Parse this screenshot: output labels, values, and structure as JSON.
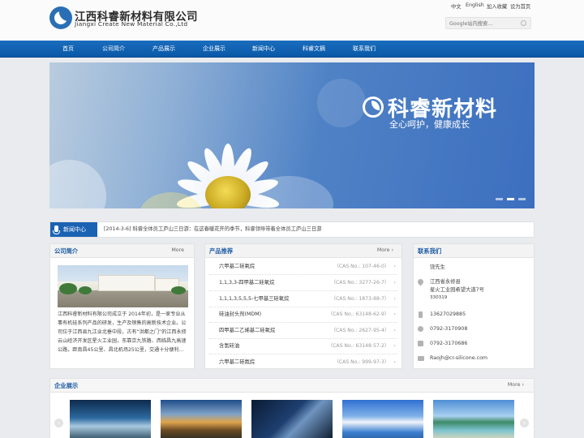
{
  "header": {
    "logo_cn": "江西科睿新材料有限公司",
    "logo_en": "Jiangxi Create New Material Co.,Ltd",
    "top_links": [
      "中文",
      "English",
      "加入收藏",
      "设为首页"
    ],
    "search_placeholder": "Google站内搜索..."
  },
  "nav": [
    "首页",
    "公司简介",
    "产品展示",
    "企业展示",
    "新闻中心",
    "科睿文摘",
    "联系我们"
  ],
  "banner": {
    "brand": "科睿新材料",
    "slogan": "全心呵护，健康成长",
    "slide_count": 3,
    "active_slide": 2
  },
  "ticker": {
    "title": "新闻中心",
    "text": "[2014-3-6]  科睿全体员工庐山三日游：在这春暖花开的季节，科睿领导带着全体员工庐山三日游"
  },
  "about": {
    "title": "公司简介",
    "more": "More",
    "text": "江西科睿新材料有限公司成立于 2014年初，是一家专业从事有机硅系列产品的研发，生产及销售的高新技术企业。公司位于江西县九江业北垂中段，古有“洪都之门”的江西永修云山经济开发区星火工业园，东靠京九铁路、西临昌九高速公路，距南昌45公里、昌北机场25公里，交通十分便利..."
  },
  "products": {
    "title": "产品推荐",
    "more": "More",
    "items": [
      {
        "name": "六甲基二硅氧烷",
        "cas": "（CAS No.: 107-46-0）"
      },
      {
        "name": "1,1,3,3-四甲基二硅氧烷",
        "cas": "（CAS No.: 3277-26-7）"
      },
      {
        "name": "1,1,1,3,5,5,5-七甲基三硅氧烷",
        "cas": "（CAS No.: 1873-88-7）"
      },
      {
        "name": "硅油封头剂(MDM)",
        "cas": "（CAS No.: 63148-62-9）"
      },
      {
        "name": "四甲基二乙烯基二硅氧烷",
        "cas": "（CAS No.: 2627-95-4）"
      },
      {
        "name": "含氢硅油",
        "cas": "（CAS No.: 63148-57-2）"
      },
      {
        "name": "六甲基二硅氮烷",
        "cas": "（CAS No.: 999-97-3）"
      }
    ]
  },
  "contact": {
    "title": "联系我们",
    "person": "饶先生",
    "address_lines": [
      "江西省永修县",
      "星火工业园希望大道7号",
      "330319"
    ],
    "mobile": "13627029885",
    "phone": "0792-3170908",
    "fax": "0792-3170686",
    "email": "Raojh@cr-silicone.com"
  },
  "showcase": {
    "title": "企业展示",
    "more": "More",
    "prev": "‹",
    "next": "›"
  }
}
